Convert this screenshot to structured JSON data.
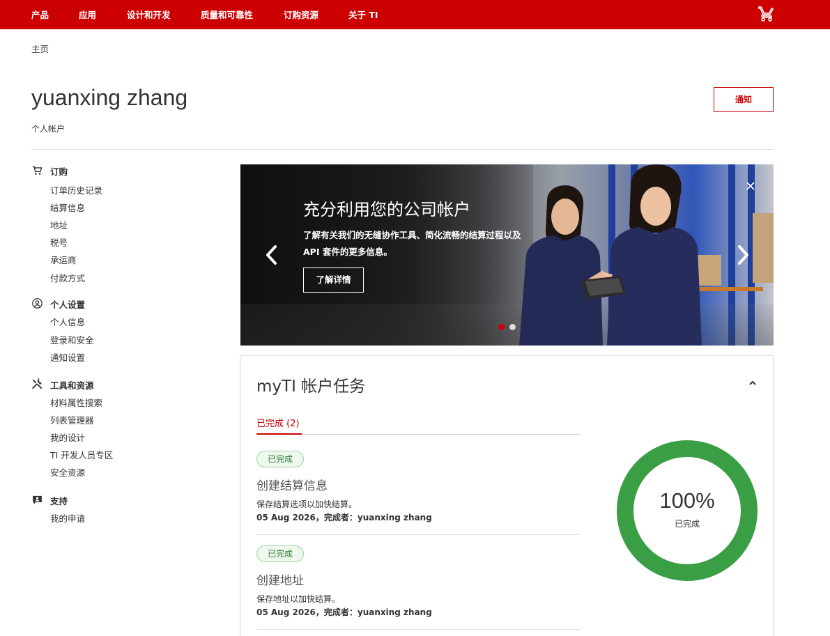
{
  "nav": {
    "items": [
      {
        "label": "产品"
      },
      {
        "label": "应用"
      },
      {
        "label": "设计和开发"
      },
      {
        "label": "质量和可靠性"
      },
      {
        "label": "订购资源"
      },
      {
        "label": "关于 TI"
      }
    ],
    "cart_icon": "cart-icon",
    "brand_color": "#cc0000"
  },
  "breadcrumb": "主页",
  "header": {
    "title": "yuanxing zhang",
    "subtitle": "个人帐户",
    "notify_label": "通知"
  },
  "sidebar": {
    "groups": [
      {
        "title": "订购",
        "icon": "cart-icon",
        "items": [
          "订单历史记录",
          "结算信息",
          "地址",
          "税号",
          "承运商",
          "付款方式"
        ]
      },
      {
        "title": "个人设置",
        "icon": "user-circle-icon",
        "items": [
          "个人信息",
          "登录和安全",
          "通知设置"
        ]
      },
      {
        "title": "工具和资源",
        "icon": "tools-icon",
        "items": [
          "材料属性搜索",
          "列表管理器",
          "我的设计",
          "TI 开发人员专区",
          "安全资源"
        ]
      },
      {
        "title": "支持",
        "icon": "support-icon",
        "items": [
          "我的申请"
        ]
      }
    ]
  },
  "banner": {
    "title": "充分利用您的公司帐户",
    "text": "了解有关我们的无缝协作工具、简化流畅的结算过程以及 API 套件的更多信息。",
    "button_label": "了解详情",
    "slide_count": 2,
    "active_slide": 1,
    "active_dot_color": "#cc0000",
    "inactive_dot_color": "#dddddd"
  },
  "tasks": {
    "title": "myTI 帐户任务",
    "tab_label": "已完成 (2)",
    "items": [
      {
        "badge": "已完成",
        "title": "创建结算信息",
        "desc": "保存结算选项以加快结算。",
        "meta": "05 Aug 2026，完成者：yuanxing zhang"
      },
      {
        "badge": "已完成",
        "title": "创建地址",
        "desc": "保存地址以加快结算。",
        "meta": "05 Aug 2026，完成者：yuanxing zhang"
      }
    ],
    "progress_percent": 100,
    "progress_text": "100%",
    "progress_label": "已完成",
    "ring_color": "#3a9e45"
  }
}
